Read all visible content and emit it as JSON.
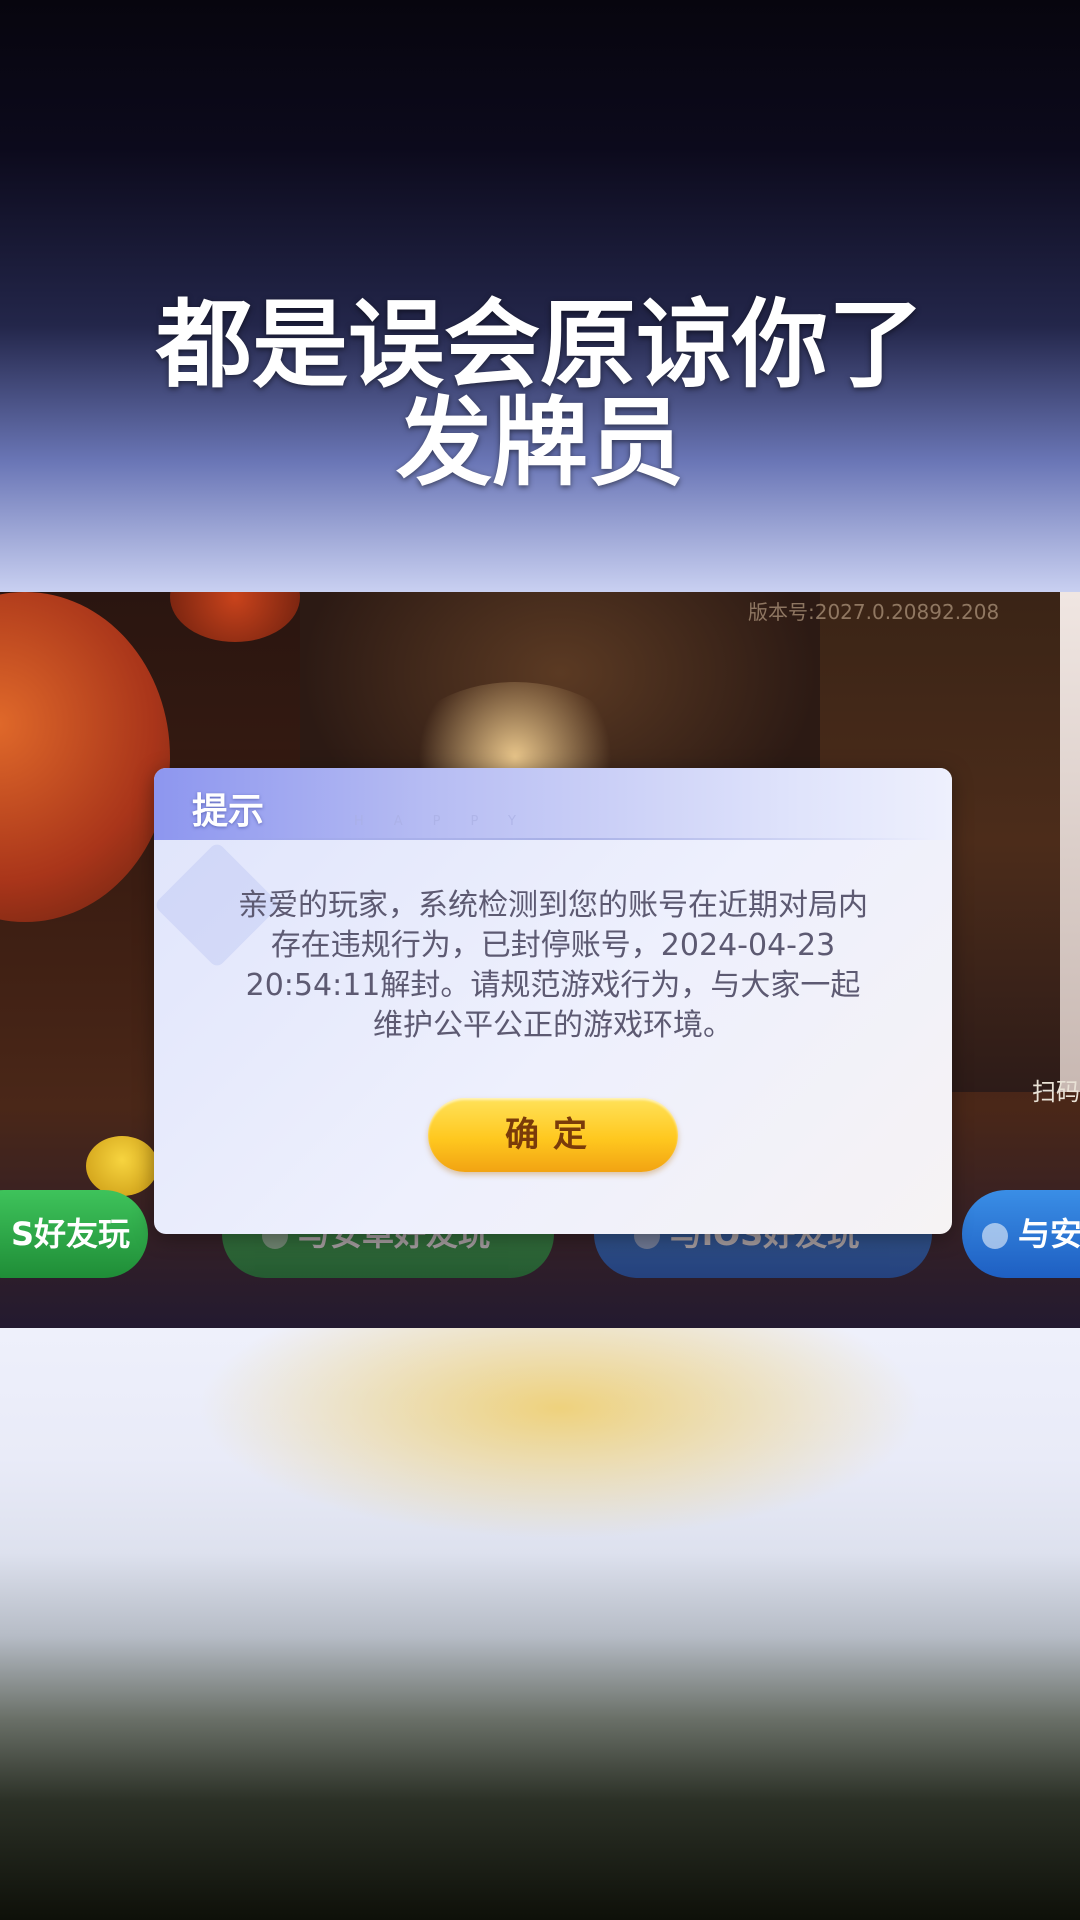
{
  "caption": {
    "line1": "都是误会原谅你了",
    "line2": "发牌员"
  },
  "game": {
    "version_text": "版本号:2027.0.20892.208",
    "side_label": "扫码",
    "buttons": [
      {
        "label": "S好友玩"
      },
      {
        "label": "与安卓好友玩"
      },
      {
        "label": "与iOS好友玩"
      },
      {
        "label": "与安"
      }
    ]
  },
  "dialog": {
    "title": "提示",
    "watermark": "HAPPY",
    "message": "亲爱的玩家，系统检测到您的账号在近期对局内存在违规行为，已封停账号，2024-04-23 20:54:11解封。请规范游戏行为，与大家一起维护公平公正的游戏环境。",
    "confirm_label": "确定"
  },
  "colors": {
    "confirm_button": "#ffc81f",
    "dialog_header": "#8d96ef",
    "green_button": "#2fae4a",
    "blue_button": "#2b77d6"
  }
}
